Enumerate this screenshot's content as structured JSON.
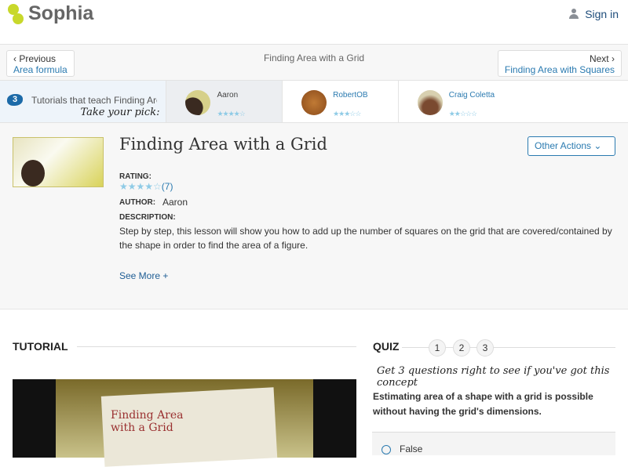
{
  "header": {
    "brand": "Sophia",
    "signin": "Sign in"
  },
  "nav": {
    "prev_label": "Previous",
    "prev_title": "Area formula",
    "title": "Finding Area with a Grid",
    "next_label": "Next",
    "next_title": "Finding Area with Squares"
  },
  "tutorials": {
    "count": "3",
    "lead": "Tutorials that teach Finding Area with a Grid",
    "pick": "Take your pick:",
    "items": [
      {
        "name": "Aaron",
        "rating": 4,
        "stars": "★★★★☆"
      },
      {
        "name": "RobertOB",
        "rating": 3,
        "stars": "★★★☆☆"
      },
      {
        "name": "Craig Coletta",
        "rating": 1.5,
        "stars": "★★☆☆☆"
      }
    ]
  },
  "lesson": {
    "title": "Finding Area with a Grid",
    "other_actions": "Other Actions",
    "rating_label": "RATING:",
    "stars": "★★★★☆",
    "rating": 4,
    "rating_count": "(7)",
    "author_label": "AUTHOR:",
    "author": "Aaron",
    "description_label": "DESCRIPTION:",
    "description": "Step by step, this lesson will show you how to add up the number of squares on the grid that are covered/contained by the shape in order to find the area of a figure.",
    "see_more": "See More +"
  },
  "tutorial": {
    "heading": "TUTORIAL",
    "video_text": "Finding Area with a Grid"
  },
  "quiz": {
    "heading": "QUIZ",
    "steps": [
      "1",
      "2",
      "3"
    ],
    "prompt": "Get 3 questions right to see if you've got this concept",
    "question": "Estimating area of a shape with a grid is possible without having the grid's dimensions.",
    "answers": [
      "False"
    ]
  }
}
